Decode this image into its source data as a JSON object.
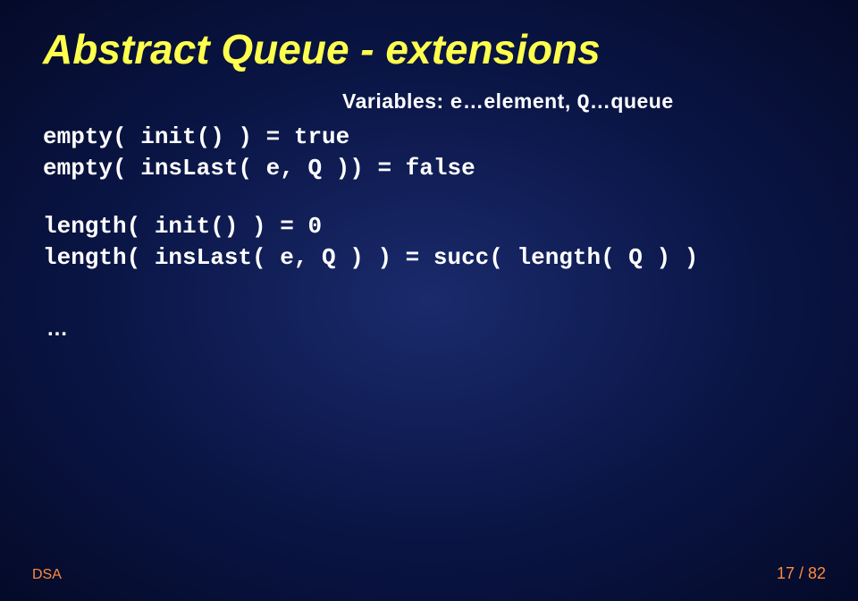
{
  "slide": {
    "title": "Abstract Queue - extensions",
    "variables_prefix": "Variables: ",
    "variables_e": "e",
    "variables_elem_text": "…element, ",
    "variables_q": "Q",
    "variables_queue_text": "…queue",
    "code1": "empty( init() ) = true\nempty( insLast( e, Q )) = false",
    "code2": "length( init() ) = 0\nlength( insLast( e, Q ) ) = succ( length( Q ) )",
    "ellipsis": "…"
  },
  "footer": {
    "left": "DSA",
    "right": "17 / 82"
  }
}
